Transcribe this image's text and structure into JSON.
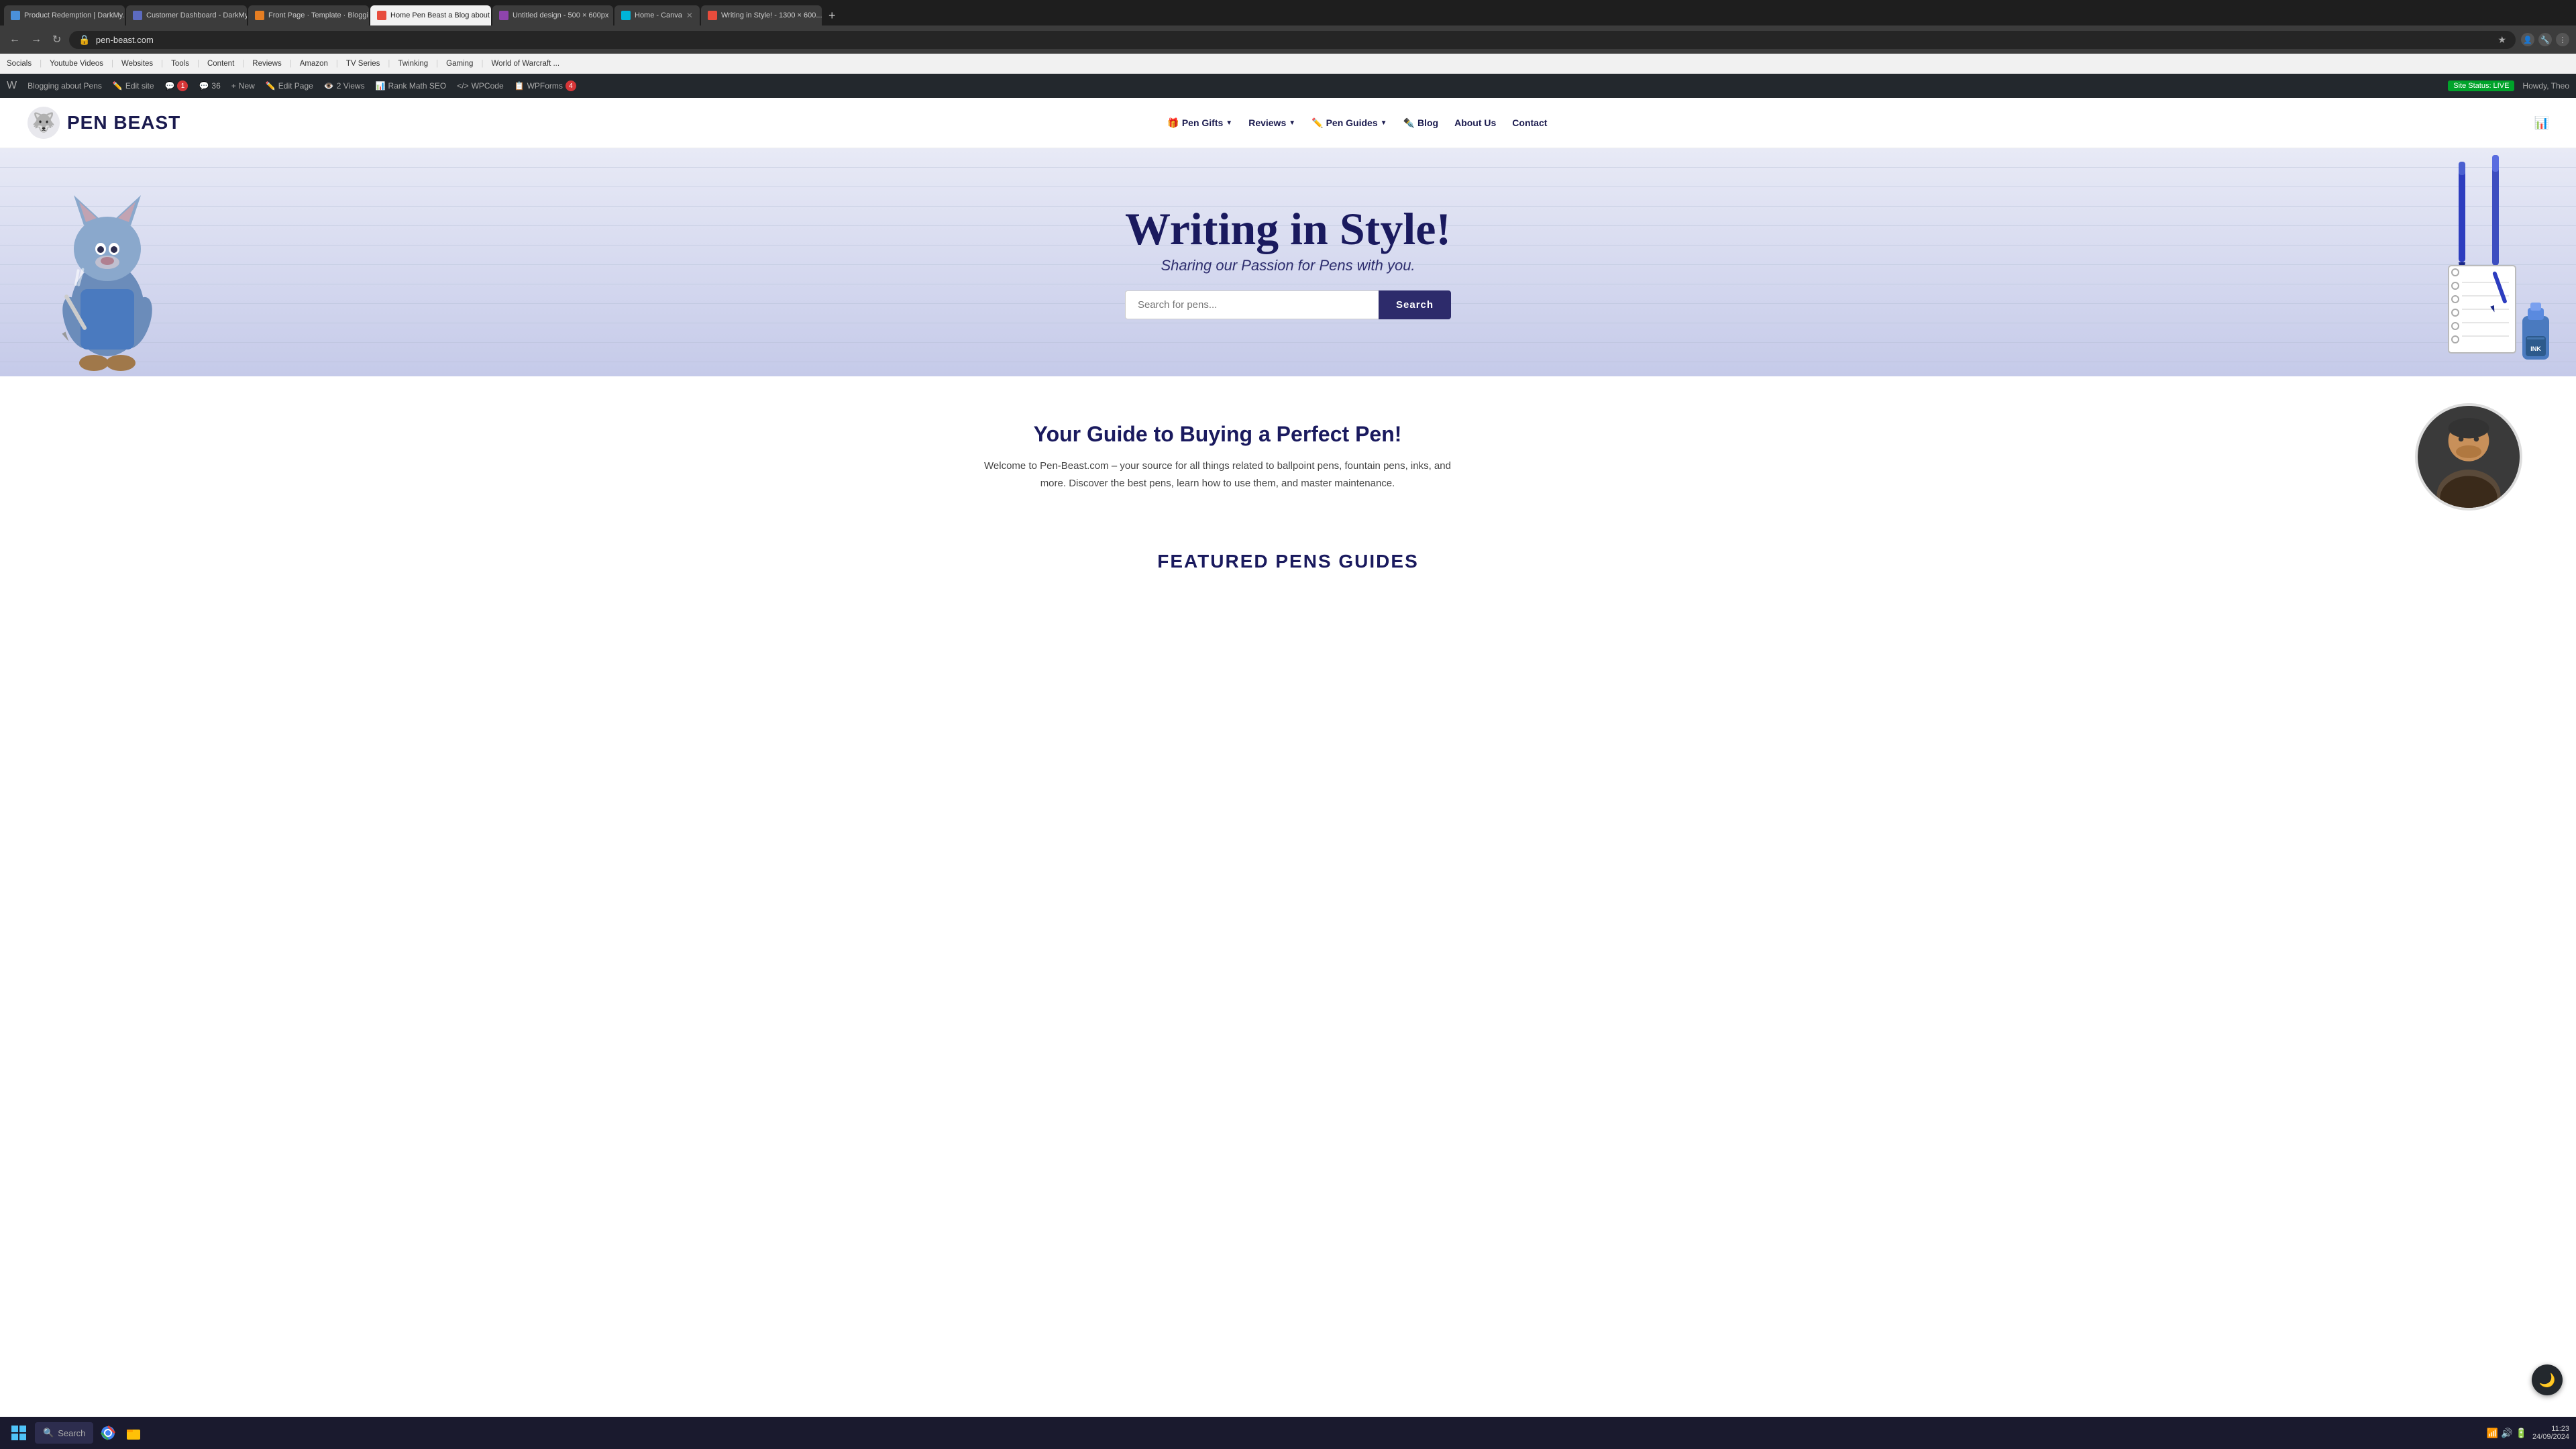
{
  "browser": {
    "tabs": [
      {
        "id": "tab1",
        "title": "Product Redemption | DarkMy...",
        "favicon_color": "#4a90d9",
        "active": false,
        "url": ""
      },
      {
        "id": "tab2",
        "title": "Customer Dashboard - DarkMy...",
        "favicon_color": "#5c6bc0",
        "active": false,
        "url": ""
      },
      {
        "id": "tab3",
        "title": "Front Page · Template · Bloggi...",
        "favicon_color": "#e67e22",
        "active": false,
        "url": ""
      },
      {
        "id": "tab4",
        "title": "Home Pen Beast a Blog about ...",
        "favicon_color": "#e74c3c",
        "active": true,
        "url": ""
      },
      {
        "id": "tab5",
        "title": "Untitled design - 500 × 600px",
        "favicon_color": "#8e44ad",
        "active": false,
        "url": ""
      },
      {
        "id": "tab6",
        "title": "Home - Canva",
        "favicon_color": "#00b4d8",
        "active": false,
        "url": ""
      },
      {
        "id": "tab7",
        "title": "Writing in Style! - 1300 × 600...",
        "favicon_color": "#e74c3c",
        "active": false,
        "url": ""
      }
    ],
    "url": "pen-beast.com",
    "bookmarks": [
      "Socials",
      "Youtube Videos",
      "Websites",
      "Tools",
      "Content",
      "Reviews",
      "Amazon",
      "TV Series",
      "Twinking",
      "Gaming",
      "World of Warcraft ..."
    ]
  },
  "wp_admin": {
    "logo": "W",
    "site_name": "Blogging about Pens",
    "edit_site": "Edit site",
    "notif_count": "1",
    "comment_count": "36",
    "new_label": "New",
    "edit_page": "Edit Page",
    "views": "2 Views",
    "seo": "Rank Math SEO",
    "wpcode": "WPCode",
    "wpforms": "WPForms",
    "wpforms_count": "4",
    "site_status": "Site Status: LIVE",
    "howdy": "Howdy, Theo"
  },
  "site": {
    "logo_text": "PEN BEAST",
    "nav_items": [
      {
        "label": "Pen Gifts",
        "has_dropdown": true
      },
      {
        "label": "Reviews",
        "has_dropdown": true
      },
      {
        "label": "Pen Guides",
        "has_dropdown": true
      },
      {
        "label": "Blog",
        "has_dropdown": false
      },
      {
        "label": "About Us",
        "has_dropdown": false
      },
      {
        "label": "Contact",
        "has_dropdown": false
      }
    ]
  },
  "hero": {
    "title": "Writing in Style!",
    "subtitle": "Sharing our Passion for Pens with you.",
    "search_placeholder": "Search for pens...",
    "search_button": "Search"
  },
  "about": {
    "title": "Your Guide to Buying a Perfect Pen!",
    "body": "Welcome to Pen-Beast.com – your source for all things related to ballpoint pens, fountain pens, inks, and more. Discover the best pens, learn how to use them, and master maintenance."
  },
  "featured": {
    "title": "FEATURED PENS GUIDES"
  },
  "taskbar": {
    "search_label": "Search",
    "clock_time": "11:23",
    "clock_date": "24/09/2024"
  },
  "icons": {
    "wolf_emoji": "🐺",
    "moon_emoji": "🌙",
    "pen_emoji": "✒️",
    "search_emoji": "🔍",
    "windows_emoji": "⊞"
  }
}
